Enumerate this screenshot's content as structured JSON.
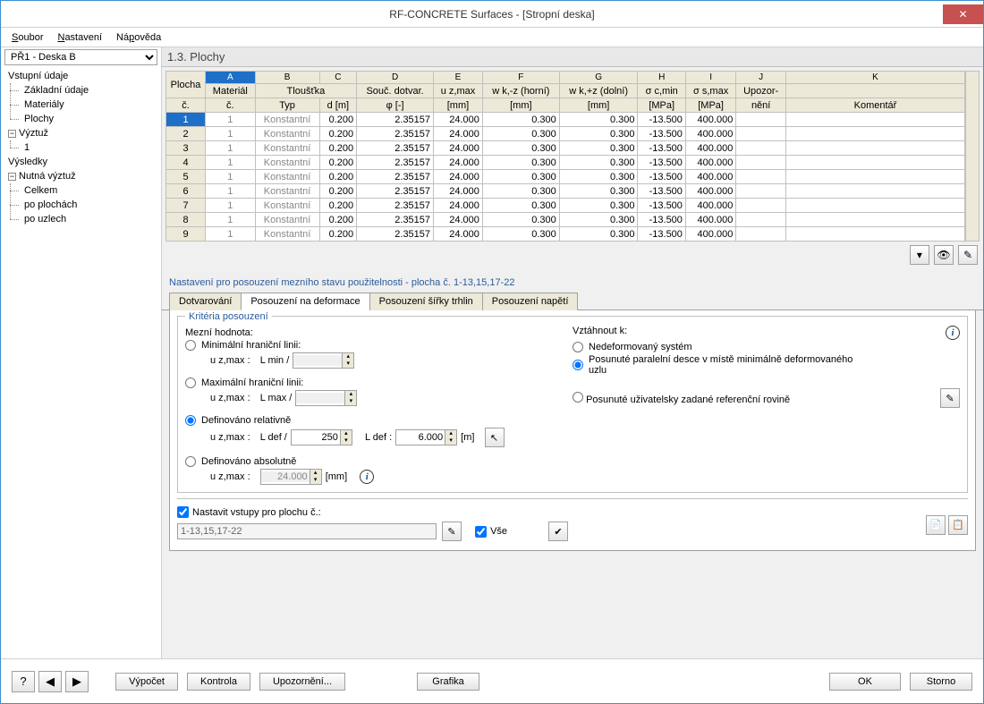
{
  "window": {
    "title": "RF-CONCRETE Surfaces - [Stropní deska]"
  },
  "menu": {
    "file": "Soubor",
    "settings": "Nastavení",
    "help": "Nápověda"
  },
  "caseSelect": "PŘ1 - Deska B",
  "tree": {
    "n0": "Vstupní údaje",
    "n01": "Základní údaje",
    "n02": "Materiály",
    "n03": "Plochy",
    "n1": "Výztuž",
    "n11": "1",
    "n2": "Výsledky",
    "n21": "Nutná výztuž",
    "n211": "Celkem",
    "n212": "po plochách",
    "n213": "po uzlech"
  },
  "sectionTitle": "1.3. Plochy",
  "grid": {
    "letters": [
      "A",
      "B",
      "C",
      "D",
      "E",
      "F",
      "G",
      "H",
      "I",
      "J",
      "K"
    ],
    "headers1": [
      "Plocha",
      "Materiál",
      "Tloušťka",
      "",
      "Souč. dotvar.",
      "u z,max",
      "w k,-z (horní)",
      "w k,+z (dolní)",
      "σ c,min",
      "σ s,max",
      "Upozor-",
      ""
    ],
    "headers2": [
      "č.",
      "č.",
      "Typ",
      "d [m]",
      "φ [-]",
      "[mm]",
      "[mm]",
      "[mm]",
      "[MPa]",
      "[MPa]",
      "nění",
      "Komentář"
    ],
    "rows": [
      {
        "n": "1",
        "mat": "1",
        "typ": "Konstantní",
        "d": "0.200",
        "phi": "2.35157",
        "uz": "24.000",
        "wkm": "0.300",
        "wkp": "0.300",
        "sc": "-13.500",
        "ss": "400.000"
      },
      {
        "n": "2",
        "mat": "1",
        "typ": "Konstantní",
        "d": "0.200",
        "phi": "2.35157",
        "uz": "24.000",
        "wkm": "0.300",
        "wkp": "0.300",
        "sc": "-13.500",
        "ss": "400.000"
      },
      {
        "n": "3",
        "mat": "1",
        "typ": "Konstantní",
        "d": "0.200",
        "phi": "2.35157",
        "uz": "24.000",
        "wkm": "0.300",
        "wkp": "0.300",
        "sc": "-13.500",
        "ss": "400.000"
      },
      {
        "n": "4",
        "mat": "1",
        "typ": "Konstantní",
        "d": "0.200",
        "phi": "2.35157",
        "uz": "24.000",
        "wkm": "0.300",
        "wkp": "0.300",
        "sc": "-13.500",
        "ss": "400.000"
      },
      {
        "n": "5",
        "mat": "1",
        "typ": "Konstantní",
        "d": "0.200",
        "phi": "2.35157",
        "uz": "24.000",
        "wkm": "0.300",
        "wkp": "0.300",
        "sc": "-13.500",
        "ss": "400.000"
      },
      {
        "n": "6",
        "mat": "1",
        "typ": "Konstantní",
        "d": "0.200",
        "phi": "2.35157",
        "uz": "24.000",
        "wkm": "0.300",
        "wkp": "0.300",
        "sc": "-13.500",
        "ss": "400.000"
      },
      {
        "n": "7",
        "mat": "1",
        "typ": "Konstantní",
        "d": "0.200",
        "phi": "2.35157",
        "uz": "24.000",
        "wkm": "0.300",
        "wkp": "0.300",
        "sc": "-13.500",
        "ss": "400.000"
      },
      {
        "n": "8",
        "mat": "1",
        "typ": "Konstantní",
        "d": "0.200",
        "phi": "2.35157",
        "uz": "24.000",
        "wkm": "0.300",
        "wkp": "0.300",
        "sc": "-13.500",
        "ss": "400.000"
      },
      {
        "n": "9",
        "mat": "1",
        "typ": "Konstantní",
        "d": "0.200",
        "phi": "2.35157",
        "uz": "24.000",
        "wkm": "0.300",
        "wkp": "0.300",
        "sc": "-13.500",
        "ss": "400.000"
      }
    ]
  },
  "panelTitle": "Nastavení pro posouzení mezního stavu použitelnosti - plocha č. 1-13,15,17-22",
  "tabs": {
    "t0": "Dotvarování",
    "t1": "Posouzení na deformace",
    "t2": "Posouzení šířky trhlin",
    "t3": "Posouzení napětí"
  },
  "criteria": {
    "box": "Kritéria posouzení",
    "leftHead": "Mezní hodnota:",
    "rightHead": "Vztáhnout k:",
    "rMin": "Minimální hraniční linii:",
    "rMax": "Maximální hraniční linii:",
    "rRel": "Definováno relativně",
    "rAbs": "Definováno absolutně",
    "uz_lbl": "u z,max :",
    "Lmin": "L min /",
    "Lmax": "L max /",
    "Ldef": "L def /",
    "LdefLbl": "L def :",
    "relVal": "250",
    "ldefVal": "6.000",
    "unit_m": "[m]",
    "absVal": "24.000",
    "unit_mm": "[mm]",
    "rSys": "Nedeformovaný systém",
    "rPar": "Posunuté paralelní desce v místě minimálně deformovaného uzlu",
    "rUser": "Posunuté uživatelsky zadané referenční rovině"
  },
  "setInputs": {
    "chk": "Nastavit vstupy pro plochu č.:",
    "val": "1-13,15,17-22",
    "all": "Vše"
  },
  "buttons": {
    "calc": "Výpočet",
    "check": "Kontrola",
    "warn": "Upozornění...",
    "gfx": "Grafika",
    "ok": "OK",
    "cancel": "Storno"
  }
}
